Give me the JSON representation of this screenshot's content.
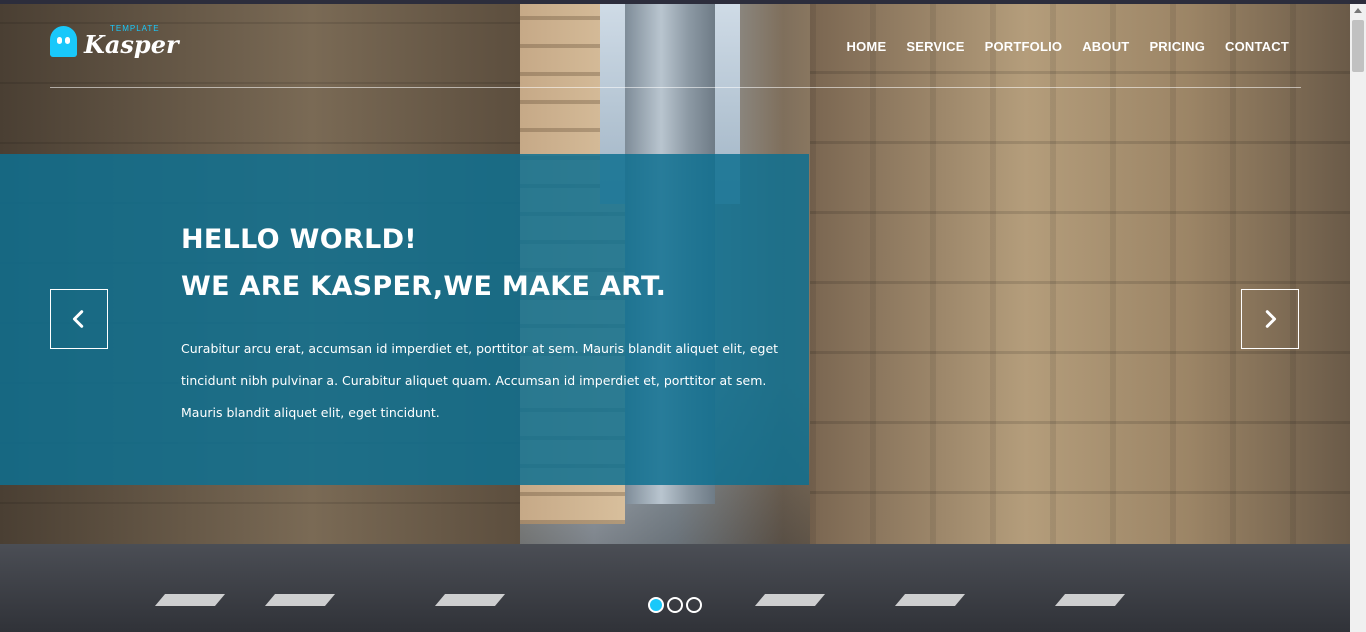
{
  "brand": {
    "name": "Kasper",
    "small_label": "TEMPLATE"
  },
  "nav": {
    "items": [
      {
        "label": "HOME"
      },
      {
        "label": "SERVICE"
      },
      {
        "label": "PORTFOLIO"
      },
      {
        "label": "ABOUT"
      },
      {
        "label": "PRICING"
      },
      {
        "label": "CONTACT"
      }
    ]
  },
  "hero": {
    "heading": "HELLO WORLD!",
    "tagline": "WE ARE KASPER,WE MAKE ART.",
    "description": "Curabitur arcu erat, accumsan id imperdiet et, porttitor at sem. Mauris blandit aliquet elit, eget tincidunt nibh pulvinar a. Curabitur aliquet quam. Accumsan id imperdiet et, porttitor at sem. Mauris blandit aliquet elit, eget tincidunt."
  },
  "slider": {
    "slide_count": 3,
    "active_index": 0
  },
  "colors": {
    "accent": "#19c8fa",
    "panel": "#0e7091",
    "text": "#ffffff"
  },
  "icons": {
    "prev": "chevron-left-icon",
    "next": "chevron-right-icon",
    "logo": "ghost-icon"
  }
}
